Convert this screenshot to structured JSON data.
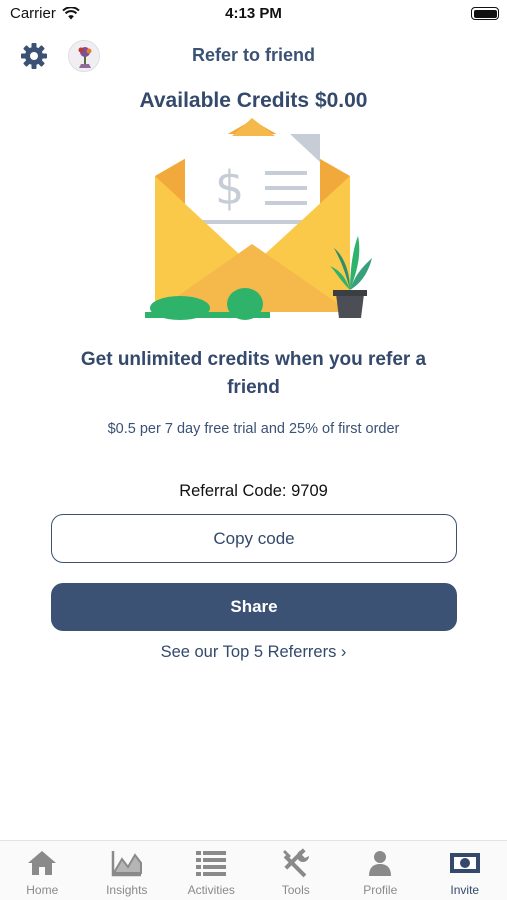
{
  "status_bar": {
    "carrier": "Carrier",
    "time": "4:13 PM"
  },
  "header": {
    "title": "Refer to friend"
  },
  "credits": {
    "text": "Available Credits $0.00"
  },
  "promo": {
    "headline": "Get unlimited credits when you refer a friend",
    "subline": "$0.5 per 7 day free trial and 25% of first order"
  },
  "referral": {
    "code_text": "Referral Code: 9709"
  },
  "buttons": {
    "copy_label": "Copy code",
    "share_label": "Share"
  },
  "top_referrers_link": "See our Top 5 Referrers ›",
  "tabs": [
    {
      "label": "Home",
      "icon": "home-icon"
    },
    {
      "label": "Insights",
      "icon": "chart-icon"
    },
    {
      "label": "Activities",
      "icon": "list-icon"
    },
    {
      "label": "Tools",
      "icon": "tools-icon"
    },
    {
      "label": "Profile",
      "icon": "person-icon"
    },
    {
      "label": "Invite",
      "icon": "cash-icon",
      "active": true
    }
  ],
  "colors": {
    "primary": "#3b5275",
    "envelope": "#f5b942",
    "plant": "#2fb36b"
  }
}
